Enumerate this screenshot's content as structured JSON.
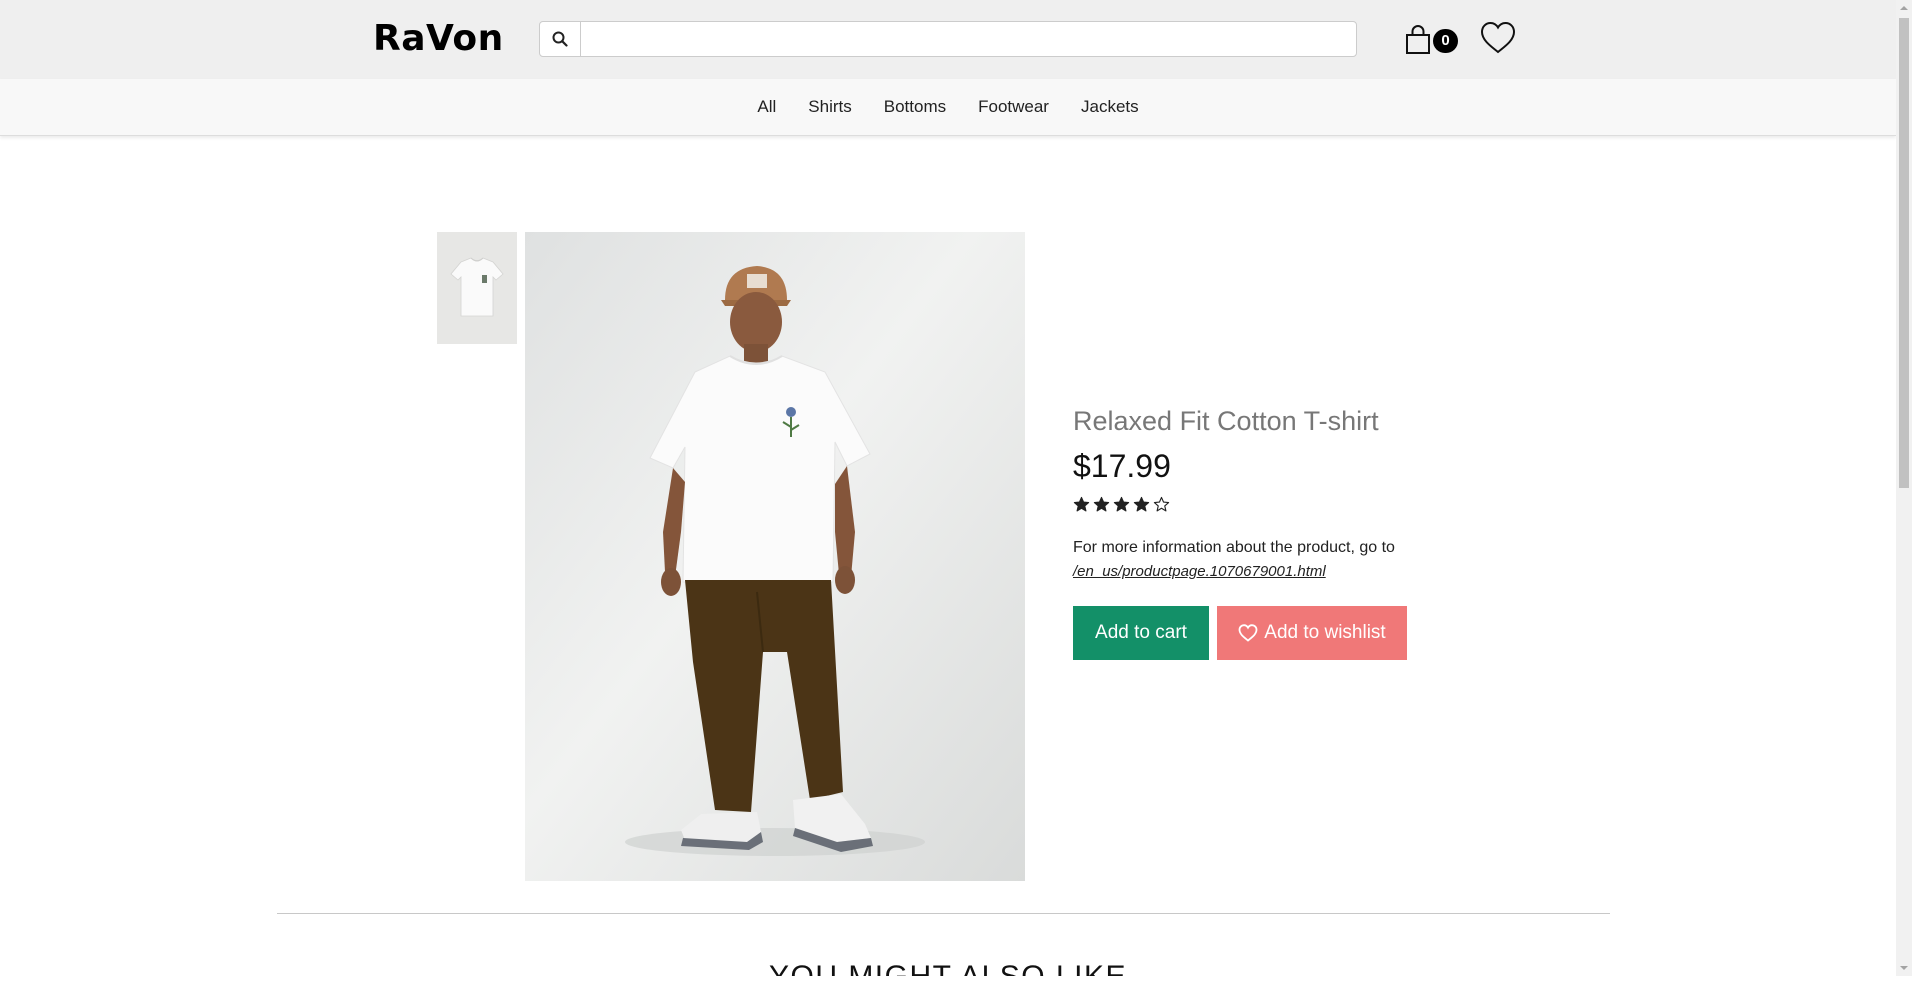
{
  "header": {
    "logo": "RaVon",
    "search": {
      "placeholder": "",
      "value": ""
    },
    "cart_count": "0"
  },
  "categories": [
    "All",
    "Shirts",
    "Bottoms",
    "Footwear",
    "Jackets"
  ],
  "product": {
    "title": "Relaxed Fit Cotton T-shirt",
    "price": "$17.99",
    "rating": 4,
    "rating_max": 5,
    "info_text": "For more information about the product, go to",
    "info_link": "/en_us/productpage.1070679001.html",
    "add_to_cart_label": "Add to cart",
    "add_to_wishlist_label": "Add to wishlist"
  },
  "section": {
    "you_might_also_like": "YOU MIGHT ALSO LIKE"
  },
  "colors": {
    "cart_button": "#139068",
    "wishlist_button": "#f07878",
    "header_bg": "#efefef"
  }
}
